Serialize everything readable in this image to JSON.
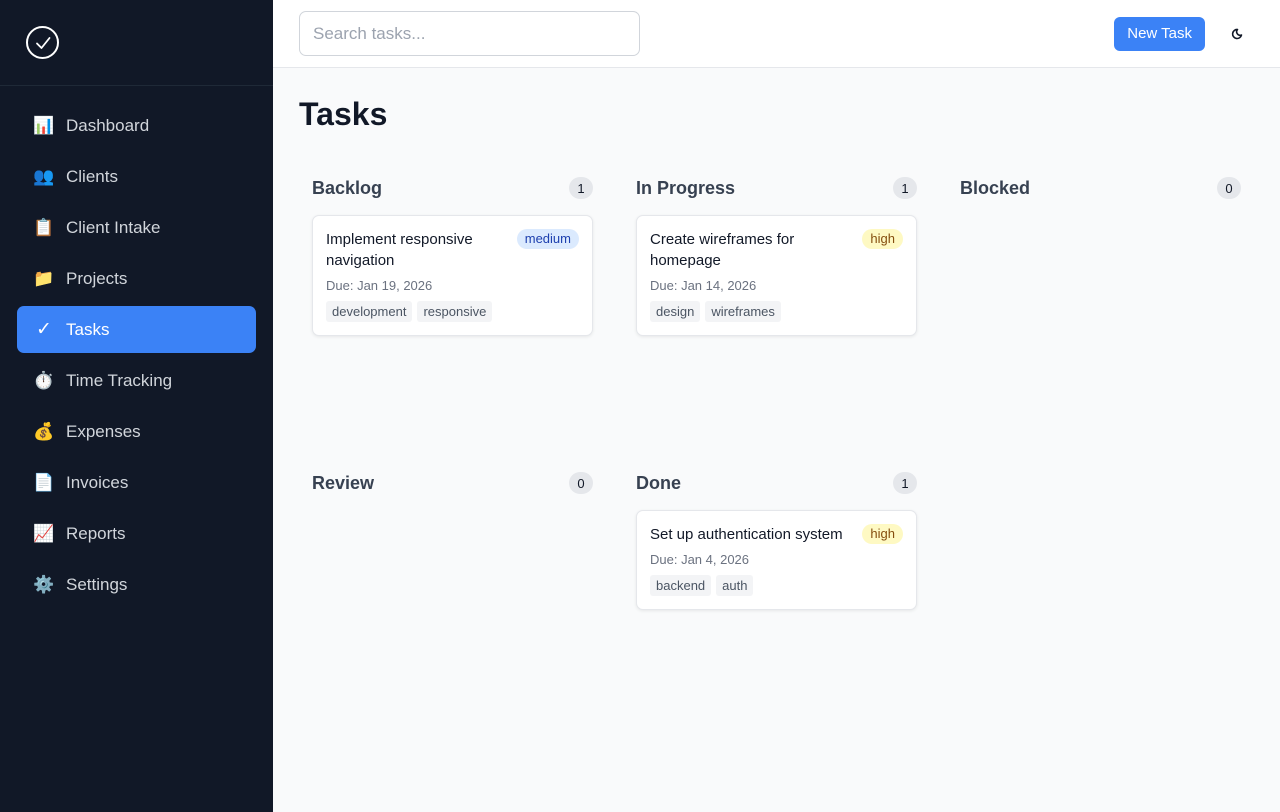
{
  "sidebar": {
    "items": [
      {
        "label": "Dashboard",
        "icon": "📊"
      },
      {
        "label": "Clients",
        "icon": "👥"
      },
      {
        "label": "Client Intake",
        "icon": "📋"
      },
      {
        "label": "Projects",
        "icon": "📁"
      },
      {
        "label": "Tasks",
        "icon": "✓",
        "active": true
      },
      {
        "label": "Time Tracking",
        "icon": "⏱️"
      },
      {
        "label": "Expenses",
        "icon": "💰"
      },
      {
        "label": "Invoices",
        "icon": "📄"
      },
      {
        "label": "Reports",
        "icon": "📈"
      },
      {
        "label": "Settings",
        "icon": "⚙️"
      }
    ]
  },
  "topbar": {
    "search_placeholder": "Search tasks...",
    "new_task_label": "New Task"
  },
  "page": {
    "title": "Tasks"
  },
  "colors": {
    "accent": "#3b82f6",
    "sidebar_bg": "#111827",
    "priority_medium_bg": "#dbeafe",
    "priority_high_bg": "#fef9c3"
  },
  "columns": [
    {
      "title": "Backlog",
      "count": "1",
      "cards": [
        {
          "title": "Implement responsive navigation",
          "priority": "medium",
          "due": "Due: Jan 19, 2026",
          "tags": [
            "development",
            "responsive"
          ]
        }
      ]
    },
    {
      "title": "In Progress",
      "count": "1",
      "cards": [
        {
          "title": "Create wireframes for homepage",
          "priority": "high",
          "due": "Due: Jan 14, 2026",
          "tags": [
            "design",
            "wireframes"
          ]
        }
      ]
    },
    {
      "title": "Blocked",
      "count": "0",
      "cards": []
    },
    {
      "title": "Review",
      "count": "0",
      "cards": []
    },
    {
      "title": "Done",
      "count": "1",
      "cards": [
        {
          "title": "Set up authentication system",
          "priority": "high",
          "due": "Due: Jan 4, 2026",
          "tags": [
            "backend",
            "auth"
          ]
        }
      ]
    }
  ]
}
